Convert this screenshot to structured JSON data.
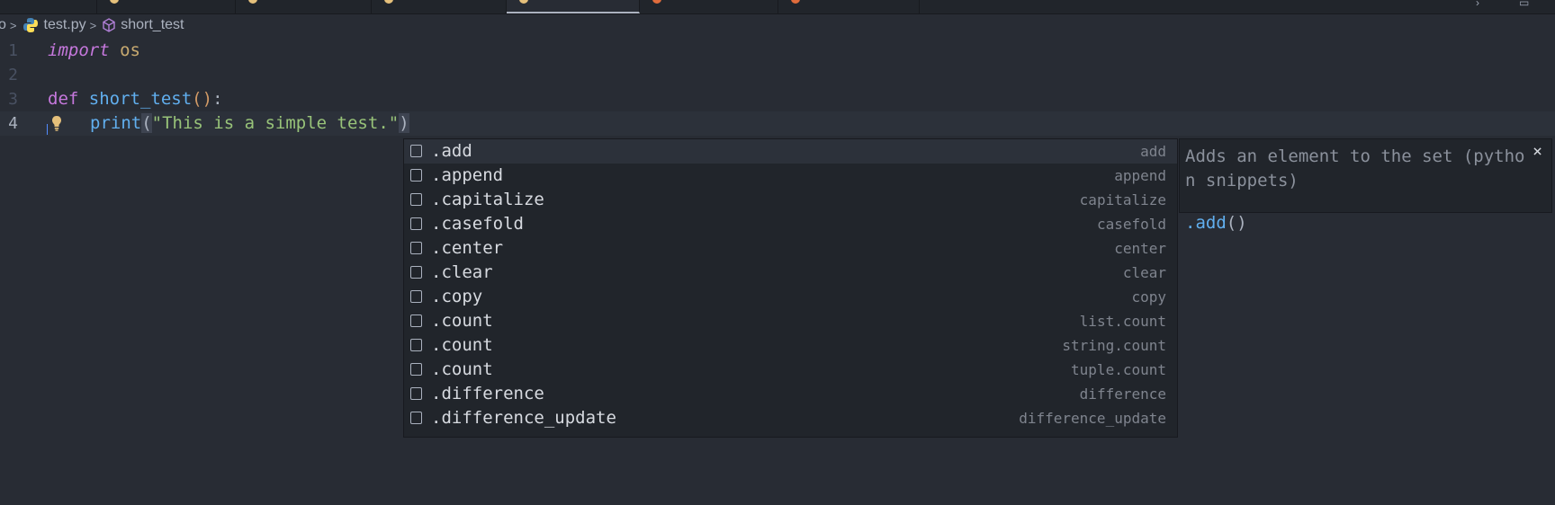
{
  "breadcrumb": {
    "file": "test.py",
    "symbol": "short_test",
    "prefix": "o"
  },
  "editor": {
    "lines": [
      {
        "number": "1",
        "kw": "import",
        "rest": " os"
      },
      {
        "number": "2"
      },
      {
        "number": "3",
        "kw": "def",
        "name": "short_test",
        "open": "(",
        "close": ")",
        "colon": ":"
      },
      {
        "number": "4",
        "indent": "  ",
        "call": "print",
        "open": "(",
        "string": "\"This is a simple test.\"",
        "close": ")"
      }
    ]
  },
  "suggestions": [
    {
      "label": ".add",
      "detail": "add"
    },
    {
      "label": ".append",
      "detail": "append"
    },
    {
      "label": ".capitalize",
      "detail": "capitalize"
    },
    {
      "label": ".casefold",
      "detail": "casefold"
    },
    {
      "label": ".center",
      "detail": "center"
    },
    {
      "label": ".clear",
      "detail": "clear"
    },
    {
      "label": ".copy",
      "detail": "copy"
    },
    {
      "label": ".count",
      "detail": "list.count"
    },
    {
      "label": ".count",
      "detail": "string.count"
    },
    {
      "label": ".count",
      "detail": "tuple.count"
    },
    {
      "label": ".difference",
      "detail": "difference"
    },
    {
      "label": ".difference_update",
      "detail": "difference_update"
    }
  ],
  "doc": {
    "description": "Adds an element to the set (python snippets)",
    "close": "×",
    "sig_name": ".add",
    "sig_parens": "()"
  },
  "colors": {
    "background": "#282c34",
    "keyword": "#c678dd",
    "function": "#61afef",
    "string": "#98c379"
  }
}
